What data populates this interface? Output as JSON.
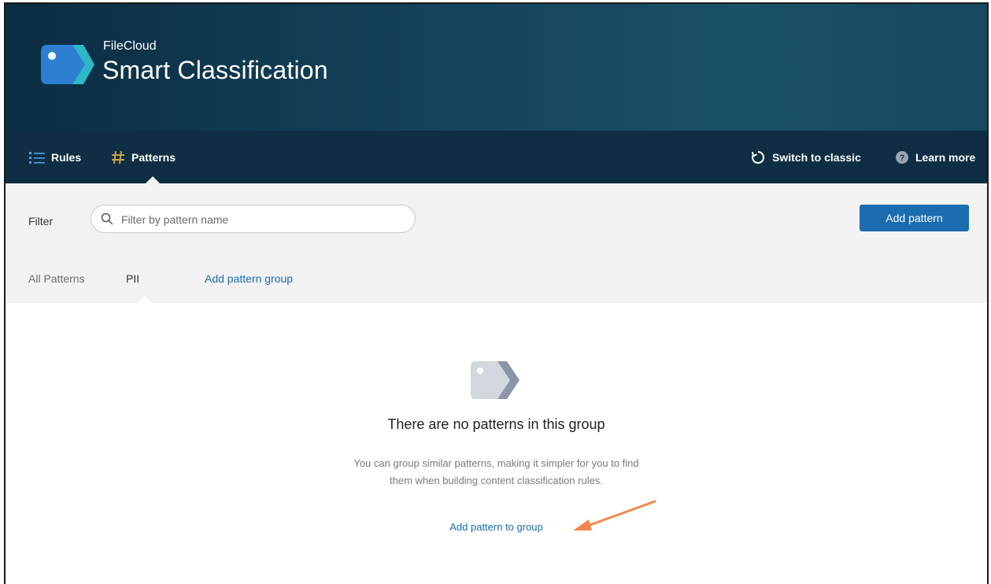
{
  "brand": {
    "small": "FileCloud",
    "large": "Smart Classification"
  },
  "nav": {
    "rules": "Rules",
    "patterns": "Patterns",
    "switch_classic": "Switch to classic",
    "learn_more": "Learn more"
  },
  "toolbar": {
    "filter_label": "Filter",
    "search_placeholder": "Filter by pattern name",
    "search_value": "",
    "add_pattern": "Add pattern"
  },
  "tabs": [
    {
      "label": "All Patterns",
      "active": false
    },
    {
      "label": "PII",
      "active": true
    },
    {
      "label": "Add pattern group",
      "active": false
    }
  ],
  "empty_state": {
    "title": "There are no patterns in this group",
    "desc_line1": "You can group similar patterns, making it simpler for you to find",
    "desc_line2": "them when building content classification rules.",
    "action": "Add pattern to group"
  },
  "colors": {
    "banner": "#14435a",
    "nav": "#0f2e44",
    "accent": "#1c6cb0",
    "annotation_arrow": "#f2864a"
  },
  "icons": {
    "logo": "tag-logo-icon",
    "rules": "list-icon",
    "patterns": "hash-icon",
    "switch": "refresh-icon",
    "learn": "help-icon",
    "search": "search-icon",
    "empty": "tag-icon"
  }
}
